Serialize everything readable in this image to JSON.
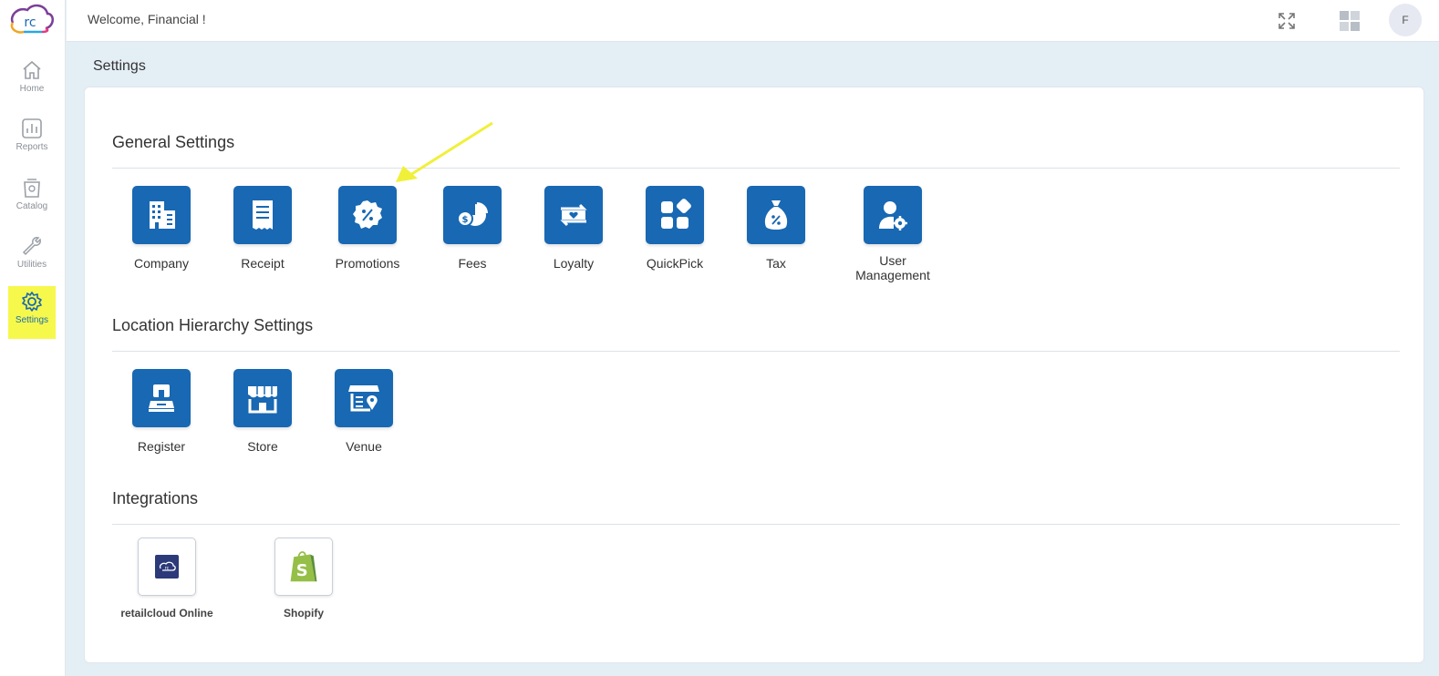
{
  "app": {
    "welcome": "Welcome, Financial !",
    "avatar_initial": "F",
    "logo_text": "rc",
    "accent": "#1868b3",
    "highlight": "#f6f84c"
  },
  "sidebar": {
    "items": [
      {
        "label": "Home",
        "icon": "home-icon"
      },
      {
        "label": "Reports",
        "icon": "bar-chart-icon"
      },
      {
        "label": "Catalog",
        "icon": "catalog-icon"
      },
      {
        "label": "Utilities",
        "icon": "wrench-icon"
      },
      {
        "label": "Settings",
        "icon": "gear-icon",
        "active": true
      }
    ]
  },
  "header": {
    "icons": [
      "fullscreen-icon",
      "grid-icon"
    ]
  },
  "page": {
    "title": "Settings"
  },
  "sections": {
    "general": {
      "title": "General Settings",
      "tiles": [
        {
          "label": "Company",
          "icon": "building-icon"
        },
        {
          "label": "Receipt",
          "icon": "receipt-icon"
        },
        {
          "label": "Promotions",
          "icon": "discount-badge-icon"
        },
        {
          "label": "Fees",
          "icon": "fees-pie-icon"
        },
        {
          "label": "Loyalty",
          "icon": "loyalty-icon"
        },
        {
          "label": "QuickPick",
          "icon": "apps-icon"
        },
        {
          "label": "Tax",
          "icon": "tax-bag-icon"
        },
        {
          "label_line1": "User",
          "label_line2": "Management",
          "icon": "user-gear-icon"
        }
      ]
    },
    "location": {
      "title": "Location Hierarchy Settings",
      "tiles": [
        {
          "label": "Register",
          "icon": "register-icon"
        },
        {
          "label": "Store",
          "icon": "store-icon"
        },
        {
          "label": "Venue",
          "icon": "venue-icon"
        }
      ]
    },
    "integrations": {
      "title": "Integrations",
      "tiles": [
        {
          "label": "retailcloud Online",
          "icon": "retailcloud-online-icon"
        },
        {
          "label": "Shopify",
          "icon": "shopify-icon"
        }
      ]
    }
  }
}
